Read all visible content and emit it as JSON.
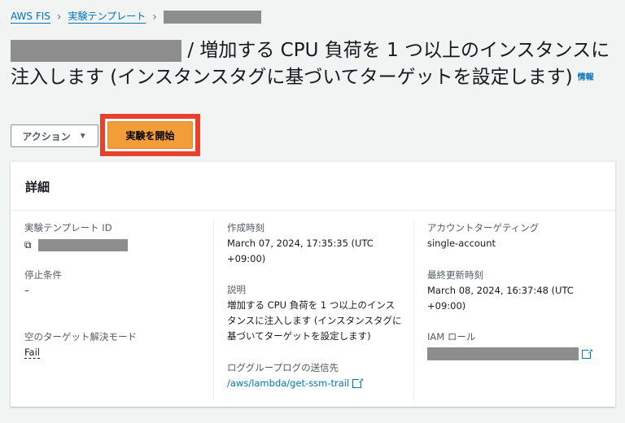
{
  "breadcrumb": {
    "items": [
      "AWS FIS",
      "実験テンプレート"
    ]
  },
  "title": {
    "text": "/ 増加する CPU 負荷を 1 つ以上のインスタンスに注入します (インスタンスタグに基づいてターゲットを設定します)",
    "info": "情報"
  },
  "actions": {
    "action_label": "アクション",
    "start_label": "実験を開始"
  },
  "details": {
    "heading": "詳細",
    "template_id_label": "実験テンプレート ID",
    "stop_label": "停止条件",
    "stop_value": "–",
    "empty_target_label": "空のターゲット解決モード",
    "empty_target_value": "Fail",
    "created_label": "作成時刻",
    "created_value": "March 07, 2024, 17:35:35 (UTC +09:00)",
    "desc_label": "説明",
    "desc_value": "増加する CPU 負荷を 1 つ以上のインスタンスに注入します (インスタンスタグに基づいてターゲットを設定します)",
    "log_label": "ロググループログの送信先",
    "log_value": "/aws/lambda/get-ssm-trail",
    "account_label": "アカウントターゲティング",
    "account_value": "single-account",
    "updated_label": "最終更新時刻",
    "updated_value": "March 08, 2024, 16:37:48 (UTC +09:00)",
    "iam_label": "IAM ロール"
  }
}
